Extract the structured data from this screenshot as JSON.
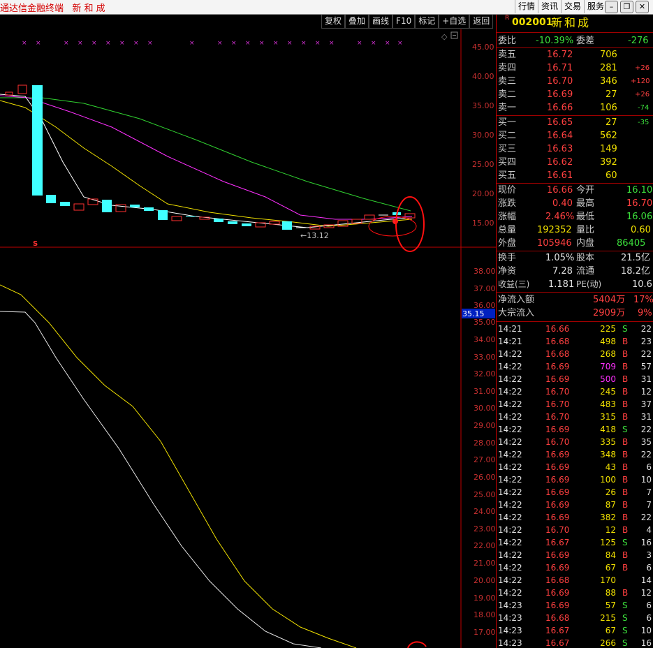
{
  "titlebar": {
    "title": "通达信金融终端   新 和 成",
    "menus": [
      "行情",
      "资讯",
      "交易",
      "服务"
    ],
    "min_icon": "minimize-icon",
    "max_icon": "restore-icon",
    "close_icon": "close-icon"
  },
  "toolbar": {
    "buttons": [
      "复权",
      "叠加",
      "画线",
      "F10",
      "标记",
      "+自选",
      "返回"
    ]
  },
  "main_chart": {
    "price_ticks": [
      "45.00",
      "40.00",
      "35.00",
      "30.00",
      "25.00",
      "20.00",
      "15.00"
    ],
    "low_label": "13.12",
    "signal_mark": "S",
    "colors": {
      "up": "#ff3030",
      "down": "#40ffff",
      "ma5": "#ffffff",
      "ma10": "#f0e000",
      "ma20": "#ff30ff",
      "ma60": "#30d030"
    }
  },
  "sub_chart": {
    "ticks": [
      "38.00",
      "37.00",
      "36.00",
      "35.00",
      "34.00",
      "33.00",
      "32.00",
      "31.00",
      "30.00",
      "29.00",
      "28.00",
      "27.00",
      "26.00",
      "25.00",
      "24.00",
      "23.00",
      "22.00",
      "21.00",
      "20.00",
      "19.00",
      "18.00",
      "17.00"
    ],
    "current_value": "35.15"
  },
  "quote": {
    "code_marker": "R",
    "code": "002001",
    "name": "新和成",
    "weibi_label": "委比",
    "weibi": "-10.39%",
    "weicha_label": "委差",
    "weicha": "-276",
    "asks": [
      {
        "label": "卖五",
        "price": "16.72",
        "vol": "706",
        "chg": ""
      },
      {
        "label": "卖四",
        "price": "16.71",
        "vol": "281",
        "chg": "+26"
      },
      {
        "label": "卖三",
        "price": "16.70",
        "vol": "346",
        "chg": "+120"
      },
      {
        "label": "卖二",
        "price": "16.69",
        "vol": "27",
        "chg": "+26"
      },
      {
        "label": "卖一",
        "price": "16.66",
        "vol": "106",
        "chg": "-74"
      }
    ],
    "bids": [
      {
        "label": "买一",
        "price": "16.65",
        "vol": "27",
        "chg": "-35"
      },
      {
        "label": "买二",
        "price": "16.64",
        "vol": "562",
        "chg": ""
      },
      {
        "label": "买三",
        "price": "16.63",
        "vol": "149",
        "chg": ""
      },
      {
        "label": "买四",
        "price": "16.62",
        "vol": "392",
        "chg": ""
      },
      {
        "label": "买五",
        "price": "16.61",
        "vol": "60",
        "chg": ""
      }
    ],
    "stats": [
      {
        "l1": "现价",
        "v1": "16.66",
        "l2": "今开",
        "v2": "16.10"
      },
      {
        "l1": "涨跌",
        "v1": "0.40",
        "l2": "最高",
        "v2": "16.70"
      },
      {
        "l1": "涨幅",
        "v1": "2.46%",
        "l2": "最低",
        "v2": "16.06"
      },
      {
        "l1": "总量",
        "v1": "192352",
        "l2": "量比",
        "v2": "0.60"
      },
      {
        "l1": "外盘",
        "v1": "105946",
        "l2": "内盘",
        "v2": "86405"
      }
    ],
    "fund": [
      {
        "l1": "换手",
        "v1": "1.05%",
        "l2": "股本",
        "v2": "21.5亿"
      },
      {
        "l1": "净资",
        "v1": "7.28",
        "l2": "流通",
        "v2": "18.2亿"
      },
      {
        "l1": "收益(三)",
        "v1": "1.181",
        "l2": "PE(动)",
        "v2": "10.6"
      }
    ],
    "flow": [
      {
        "label": "净流入额",
        "value": "5404万",
        "pct": "17%"
      },
      {
        "label": "大宗流入",
        "value": "2909万",
        "pct": "9%"
      }
    ]
  },
  "ticks": [
    {
      "t": "14:21",
      "p": "16.66",
      "v": "225",
      "s": "S",
      "n": "22"
    },
    {
      "t": "14:21",
      "p": "16.68",
      "v": "498",
      "s": "B",
      "n": "23"
    },
    {
      "t": "14:22",
      "p": "16.68",
      "v": "268",
      "s": "B",
      "n": "22"
    },
    {
      "t": "14:22",
      "p": "16.69",
      "v": "709",
      "s": "B",
      "n": "57"
    },
    {
      "t": "14:22",
      "p": "16.69",
      "v": "500",
      "s": "B",
      "n": "31"
    },
    {
      "t": "14:22",
      "p": "16.70",
      "v": "245",
      "s": "B",
      "n": "12"
    },
    {
      "t": "14:22",
      "p": "16.70",
      "v": "483",
      "s": "B",
      "n": "37"
    },
    {
      "t": "14:22",
      "p": "16.70",
      "v": "315",
      "s": "B",
      "n": "31"
    },
    {
      "t": "14:22",
      "p": "16.69",
      "v": "418",
      "s": "S",
      "n": "22"
    },
    {
      "t": "14:22",
      "p": "16.70",
      "v": "335",
      "s": "B",
      "n": "35"
    },
    {
      "t": "14:22",
      "p": "16.69",
      "v": "348",
      "s": "B",
      "n": "22"
    },
    {
      "t": "14:22",
      "p": "16.69",
      "v": "43",
      "s": "B",
      "n": "6"
    },
    {
      "t": "14:22",
      "p": "16.69",
      "v": "100",
      "s": "B",
      "n": "10"
    },
    {
      "t": "14:22",
      "p": "16.69",
      "v": "26",
      "s": "B",
      "n": "7"
    },
    {
      "t": "14:22",
      "p": "16.69",
      "v": "87",
      "s": "B",
      "n": "7"
    },
    {
      "t": "14:22",
      "p": "16.69",
      "v": "382",
      "s": "B",
      "n": "22"
    },
    {
      "t": "14:22",
      "p": "16.70",
      "v": "12",
      "s": "B",
      "n": "4"
    },
    {
      "t": "14:22",
      "p": "16.67",
      "v": "125",
      "s": "S",
      "n": "16"
    },
    {
      "t": "14:22",
      "p": "16.69",
      "v": "84",
      "s": "B",
      "n": "3"
    },
    {
      "t": "14:22",
      "p": "16.69",
      "v": "67",
      "s": "B",
      "n": "6"
    },
    {
      "t": "14:22",
      "p": "16.68",
      "v": "170",
      "s": "",
      "n": "14"
    },
    {
      "t": "14:22",
      "p": "16.69",
      "v": "88",
      "s": "B",
      "n": "12"
    },
    {
      "t": "14:23",
      "p": "16.69",
      "v": "57",
      "s": "S",
      "n": "6"
    },
    {
      "t": "14:23",
      "p": "16.68",
      "v": "215",
      "s": "S",
      "n": "6"
    },
    {
      "t": "14:23",
      "p": "16.67",
      "v": "67",
      "s": "S",
      "n": "10"
    },
    {
      "t": "14:23",
      "p": "16.67",
      "v": "266",
      "s": "S",
      "n": "16"
    }
  ]
}
